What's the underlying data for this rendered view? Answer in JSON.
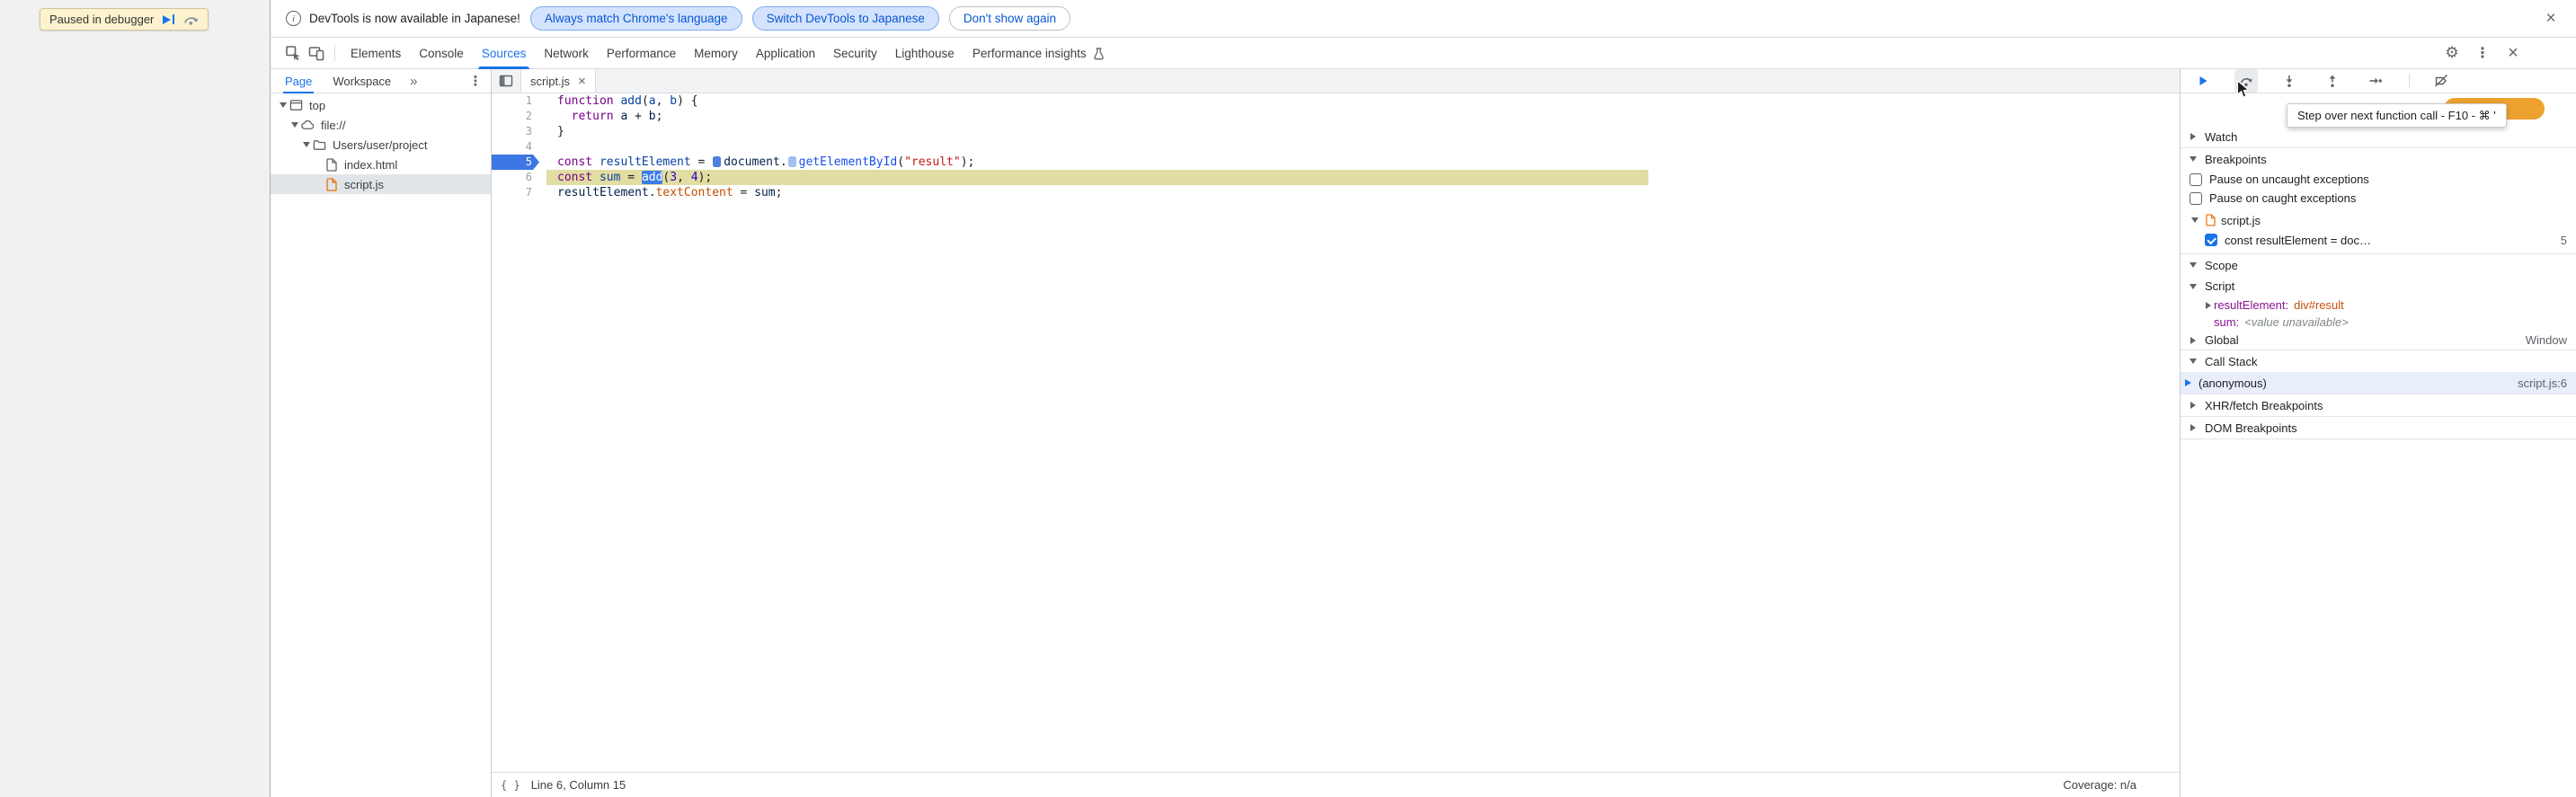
{
  "page": {
    "paused_label": "Paused in debugger"
  },
  "banner": {
    "message": "DevTools is now available in Japanese!",
    "btn_match": "Always match Chrome's language",
    "btn_switch": "Switch DevTools to Japanese",
    "btn_dismiss": "Don't show again"
  },
  "tabs": {
    "items": [
      "Elements",
      "Console",
      "Sources",
      "Network",
      "Performance",
      "Memory",
      "Application",
      "Security",
      "Lighthouse",
      "Performance insights"
    ],
    "selected": "Sources"
  },
  "icons": {
    "gear": "⚙",
    "kebab": "⋮",
    "close": "×",
    "more_tabs": "»",
    "info": "i",
    "braces": "{ }"
  },
  "colors": {
    "accent_blue": "#1A73E8",
    "breakpoint_blue": "#3D77E3",
    "execution_line_olive": "#E2DDA2",
    "paused_status_orange": "#EDA12F",
    "selected_frame_bg": "#E9EEFB"
  },
  "navigator": {
    "tab_page": "Page",
    "tab_workspace": "Workspace",
    "tree": [
      {
        "label": "top"
      },
      {
        "label": "file://"
      },
      {
        "label": "Users/user/project"
      },
      {
        "label": "index.html"
      },
      {
        "label": "script.js"
      }
    ]
  },
  "editor": {
    "tab_label": "script.js",
    "status_position": "Line 6, Column 15",
    "status_coverage": "Coverage: n/a",
    "lines": [
      {
        "num": "1",
        "tokens": [
          {
            "t": "function",
            "c": "kw"
          },
          {
            "t": " ",
            "c": "pl"
          },
          {
            "t": "add",
            "c": "def"
          },
          {
            "t": "(",
            "c": "pl"
          },
          {
            "t": "a",
            "c": "def"
          },
          {
            "t": ", ",
            "c": "pl"
          },
          {
            "t": "b",
            "c": "def"
          },
          {
            "t": ") {",
            "c": "pl"
          }
        ]
      },
      {
        "num": "2",
        "tokens": [
          {
            "t": "  ",
            "c": "pl"
          },
          {
            "t": "return",
            "c": "kw"
          },
          {
            "t": " ",
            "c": "pl"
          },
          {
            "t": "a",
            "c": "var"
          },
          {
            "t": " + ",
            "c": "pl"
          },
          {
            "t": "b",
            "c": "var"
          },
          {
            "t": ";",
            "c": "pl"
          }
        ]
      },
      {
        "num": "3",
        "tokens": [
          {
            "t": "}",
            "c": "pl"
          }
        ]
      },
      {
        "num": "4",
        "tokens": []
      },
      {
        "num": "5",
        "bp": true,
        "tokens": [
          {
            "t": "const",
            "c": "kw"
          },
          {
            "t": " ",
            "c": "pl"
          },
          {
            "t": "resultElement",
            "c": "def"
          },
          {
            "t": " = ",
            "c": "pl"
          },
          {
            "t": "",
            "c": "mark1"
          },
          {
            "t": "document",
            "c": "var"
          },
          {
            "t": ".",
            "c": "pl"
          },
          {
            "t": "",
            "c": "mark2"
          },
          {
            "t": "getElementById",
            "c": "fn"
          },
          {
            "t": "(",
            "c": "pl"
          },
          {
            "t": "\"result\"",
            "c": "str"
          },
          {
            "t": ");",
            "c": "pl"
          }
        ]
      },
      {
        "num": "6",
        "exec": true,
        "tokens": [
          {
            "t": "const",
            "c": "kw"
          },
          {
            "t": " ",
            "c": "pl"
          },
          {
            "t": "sum",
            "c": "def"
          },
          {
            "t": " = ",
            "c": "pl"
          },
          {
            "t": "add",
            "c": "sel"
          },
          {
            "t": "(",
            "c": "pl"
          },
          {
            "t": "3",
            "c": "num"
          },
          {
            "t": ", ",
            "c": "pl"
          },
          {
            "t": "4",
            "c": "num"
          },
          {
            "t": ");",
            "c": "pl"
          }
        ]
      },
      {
        "num": "7",
        "tokens": [
          {
            "t": "resultElement",
            "c": "var"
          },
          {
            "t": ".",
            "c": "pl"
          },
          {
            "t": "textContent",
            "c": "prop"
          },
          {
            "t": " = ",
            "c": "pl"
          },
          {
            "t": "sum",
            "c": "var"
          },
          {
            "t": ";",
            "c": "pl"
          }
        ]
      }
    ]
  },
  "debugger": {
    "tooltip": "Step over next function call - F10 - ⌘ '",
    "watch_label": "Watch",
    "breakpoints_label": "Breakpoints",
    "pause_uncaught": "Pause on uncaught exceptions",
    "pause_caught": "Pause on caught exceptions",
    "breakpoint_file": "script.js",
    "breakpoint_snippet": "const resultElement = doc…",
    "breakpoint_line": "5",
    "scope_label": "Scope",
    "scope_script_label": "Script",
    "var1_name": "resultElement:",
    "var1_value": "div#result",
    "var2_name": "sum:",
    "var2_value": "<value unavailable>",
    "global_label": "Global",
    "global_value": "Window",
    "callstack_label": "Call Stack",
    "frame_name": "(anonymous)",
    "frame_location": "script.js:6",
    "xhr_label": "XHR/fetch Breakpoints",
    "dom_label": "DOM Breakpoints"
  }
}
